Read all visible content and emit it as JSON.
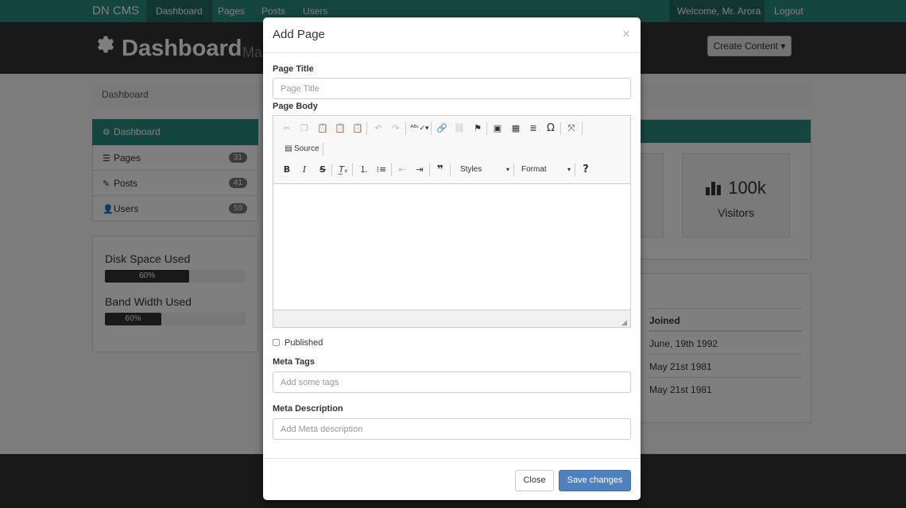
{
  "navbar": {
    "brand": "DN CMS",
    "items": [
      "Dashboard",
      "Pages",
      "Posts",
      "Users"
    ],
    "welcome": "Welcome, Mr. Arora",
    "logout": "Logout",
    "accent": "#2b8a7e"
  },
  "header": {
    "title": "Dashboard",
    "subtitle": "Ma",
    "create_button": "Create Content ▾"
  },
  "breadcrumb": "Dashboard",
  "sidebar": {
    "items": [
      {
        "label": "Dashboard",
        "icon": "gear-icon"
      },
      {
        "label": "Pages",
        "icon": "list-icon",
        "count": "31"
      },
      {
        "label": "Posts",
        "icon": "pencil-icon",
        "count": "41"
      },
      {
        "label": "Users",
        "icon": "user-icon",
        "count": "59"
      }
    ]
  },
  "usage": {
    "disk": {
      "label": "Disk Space Used",
      "value": "60%"
    },
    "bandwidth": {
      "label": "Band Width Used",
      "value": "60%"
    }
  },
  "stats": {
    "visitors": {
      "value": "100k",
      "label": "Visitors",
      "icon": "bar-chart-icon"
    }
  },
  "users_table": {
    "header": "Joined",
    "rows": [
      "June, 19th 1992",
      "May 21st 1981",
      "May 21st 1981"
    ]
  },
  "modal": {
    "title": "Add Page",
    "close_icon": "×",
    "page_title_label": "Page Title",
    "page_title_placeholder": "Page Title",
    "page_body_label": "Page Body",
    "editor": {
      "source_label": "Source",
      "styles_label": "Styles",
      "format_label": "Format"
    },
    "published_label": "Published",
    "meta_tags_label": "Meta Tags",
    "meta_tags_placeholder": "Add some tags",
    "meta_description_label": "Meta Description",
    "meta_description_placeholder": "Add Meta description",
    "close_button": "Close",
    "save_button": "Save changes"
  }
}
